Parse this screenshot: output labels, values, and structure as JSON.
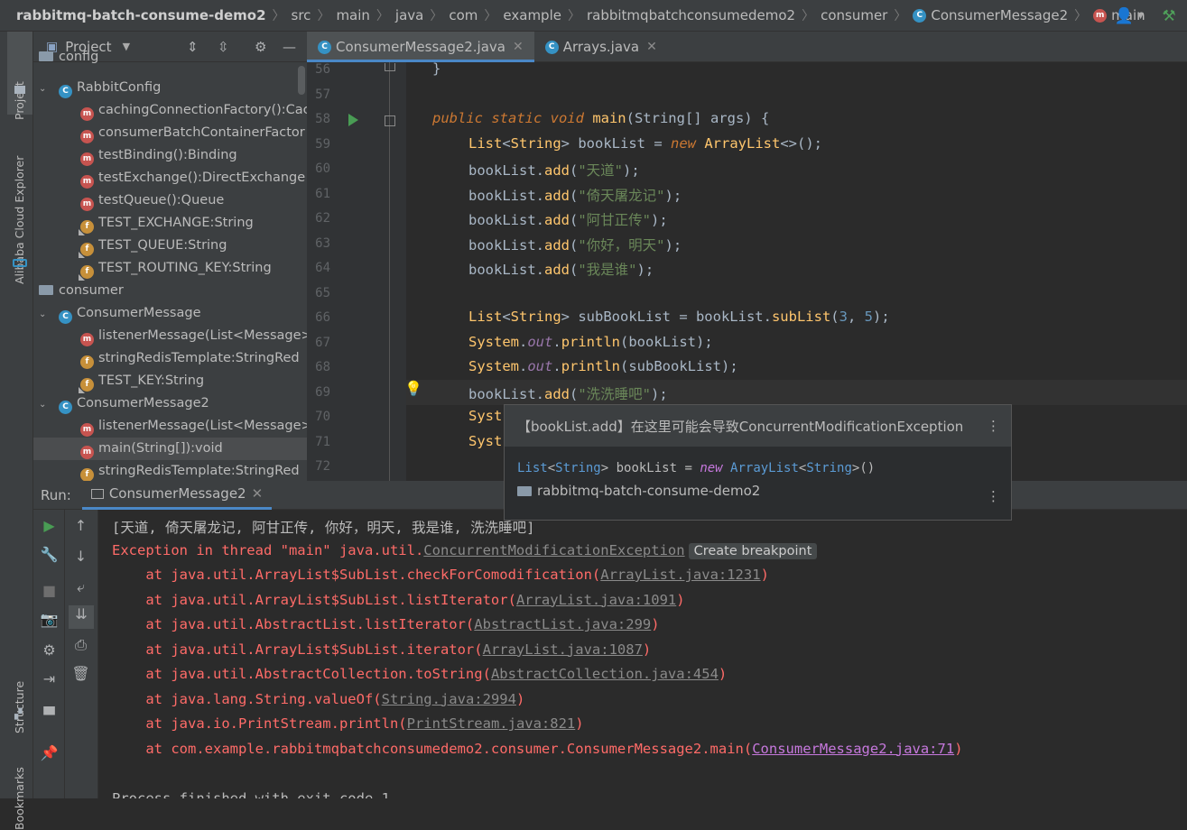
{
  "breadcrumb": {
    "items": [
      "rabbitmq-batch-consume-demo2",
      "src",
      "main",
      "java",
      "com",
      "example",
      "rabbitmqbatchconsumedemo2",
      "consumer",
      "ConsumerMessage2",
      "main"
    ]
  },
  "sidebar_tabs": {
    "project": "Project",
    "alibaba": "Alibaba Cloud Explorer",
    "structure": "Structure",
    "bookmarks": "Bookmarks"
  },
  "project_panel": {
    "title": "Project",
    "tree": [
      {
        "type": "folder",
        "label": "config",
        "indent": 0
      },
      {
        "type": "class",
        "label": "RabbitConfig",
        "indent": 1,
        "arrow": "⌄"
      },
      {
        "type": "method",
        "label": "cachingConnectionFactory():Cac",
        "indent": 2
      },
      {
        "type": "method",
        "label": "consumerBatchContainerFactor",
        "indent": 2
      },
      {
        "type": "method",
        "label": "testBinding():Binding",
        "indent": 2
      },
      {
        "type": "method",
        "label": "testExchange():DirectExchange",
        "indent": 2
      },
      {
        "type": "method",
        "label": "testQueue():Queue",
        "indent": 2
      },
      {
        "type": "field",
        "label": "TEST_EXCHANGE:String",
        "indent": 2,
        "final": true
      },
      {
        "type": "field",
        "label": "TEST_QUEUE:String",
        "indent": 2,
        "final": true
      },
      {
        "type": "field",
        "label": "TEST_ROUTING_KEY:String",
        "indent": 2,
        "final": true
      },
      {
        "type": "folder",
        "label": "consumer",
        "indent": 0
      },
      {
        "type": "class",
        "label": "ConsumerMessage",
        "indent": 1,
        "arrow": "⌄"
      },
      {
        "type": "method",
        "label": "listenerMessage(List<Message>",
        "indent": 2
      },
      {
        "type": "field",
        "label": "stringRedisTemplate:StringRed",
        "indent": 2
      },
      {
        "type": "field",
        "label": "TEST_KEY:String",
        "indent": 2,
        "final": true
      },
      {
        "type": "class",
        "label": "ConsumerMessage2",
        "indent": 1,
        "arrow": "⌄"
      },
      {
        "type": "method",
        "label": "listenerMessage(List<Message>",
        "indent": 2
      },
      {
        "type": "method",
        "label": "main(String[]):void",
        "indent": 2,
        "selected": true
      },
      {
        "type": "field",
        "label": "stringRedisTemplate:StringRed",
        "indent": 2
      }
    ]
  },
  "editor": {
    "tabs": [
      {
        "label": "ConsumerMessage2.java",
        "active": true
      },
      {
        "label": "Arrays.java",
        "active": false
      }
    ],
    "lines": [
      {
        "n": "56",
        "html": "<span class=\"nm\">}</span>",
        "indent": 1
      },
      {
        "n": "57",
        "html": "",
        "indent": 0
      },
      {
        "n": "58",
        "html": "<span class=\"kw\">public static void </span><span class=\"fn\">main</span>(String[] args) {",
        "indent": 1
      },
      {
        "n": "59",
        "html": "<span class=\"cls\">List</span>&lt;<span class=\"cls\">String</span>&gt; bookList = <span class=\"kw\">new </span><span class=\"cls\">ArrayList</span>&lt;&gt;();",
        "indent": 2
      },
      {
        "n": "60",
        "html": "bookList.<span class=\"fn\">add</span>(<span class=\"str\">\"天道\"</span>);",
        "indent": 2
      },
      {
        "n": "61",
        "html": "bookList.<span class=\"fn\">add</span>(<span class=\"str\">\"倚天屠龙记\"</span>);",
        "indent": 2
      },
      {
        "n": "62",
        "html": "bookList.<span class=\"fn\">add</span>(<span class=\"str\">\"阿甘正传\"</span>);",
        "indent": 2
      },
      {
        "n": "63",
        "html": "bookList.<span class=\"fn\">add</span>(<span class=\"str\">\"你好，明天\"</span>);",
        "indent": 2
      },
      {
        "n": "64",
        "html": "bookList.<span class=\"fn\">add</span>(<span class=\"str\">\"我是谁\"</span>);",
        "indent": 2
      },
      {
        "n": "65",
        "html": "",
        "indent": 0
      },
      {
        "n": "66",
        "html": "<span class=\"cls\">List</span>&lt;<span class=\"cls\">String</span>&gt; subBookList = bookList.<span class=\"fn\">subList</span>(<span class=\"num\">3</span>, <span class=\"num\">5</span>);",
        "indent": 2
      },
      {
        "n": "67",
        "html": "<span class=\"cls\">System</span>.<span class=\"fld\">out</span>.<span class=\"fn\">println</span>(bookList);",
        "indent": 2
      },
      {
        "n": "68",
        "html": "<span class=\"cls\">System</span>.<span class=\"fld\">out</span>.<span class=\"fn\">println</span>(subBookList);",
        "indent": 2
      },
      {
        "n": "69",
        "html": "bookList.<span class=\"fn\">add</span>(<span class=\"str\">\"洗洗睡吧\"</span>);",
        "indent": 2
      },
      {
        "n": "70",
        "html": "<span class=\"cls\">Syst</span>",
        "indent": 2
      },
      {
        "n": "71",
        "html": "<span class=\"cls\">Syst</span>",
        "indent": 2
      },
      {
        "n": "72",
        "html": "",
        "indent": 0
      }
    ]
  },
  "popup": {
    "message": "【bookList.add】在这里可能会导致ConcurrentModificationException",
    "signature": "List<String> bookList = new ArrayList<String>()",
    "module": "rabbitmq-batch-consume-demo2"
  },
  "run_panel": {
    "label": "Run:",
    "tab": "ConsumerMessage2",
    "output": "[天道, 倚天屠龙记, 阿甘正传, 你好，明天, 我是谁, 洗洗睡吧]",
    "exception_prefix": "Exception in thread \"main\" java.util.",
    "exception_class": "ConcurrentModificationException",
    "create_breakpoint": "Create breakpoint",
    "stack": [
      {
        "at": "java.util.ArrayList$SubList.checkForComodification(",
        "file": "ArrayList.java:1231"
      },
      {
        "at": "java.util.ArrayList$SubList.listIterator(",
        "file": "ArrayList.java:1091"
      },
      {
        "at": "java.util.AbstractList.listIterator(",
        "file": "AbstractList.java:299"
      },
      {
        "at": "java.util.ArrayList$SubList.iterator(",
        "file": "ArrayList.java:1087"
      },
      {
        "at": "java.util.AbstractCollection.toString(",
        "file": "AbstractCollection.java:454"
      },
      {
        "at": "java.lang.String.valueOf(",
        "file": "String.java:2994"
      },
      {
        "at": "java.io.PrintStream.println(",
        "file": "PrintStream.java:821"
      },
      {
        "at": "com.example.rabbitmqbatchconsumedemo2.consumer.ConsumerMessage2.main(",
        "file": "ConsumerMessage2.java:71",
        "highlight": true
      }
    ],
    "finish": "Process finished with exit code 1"
  }
}
